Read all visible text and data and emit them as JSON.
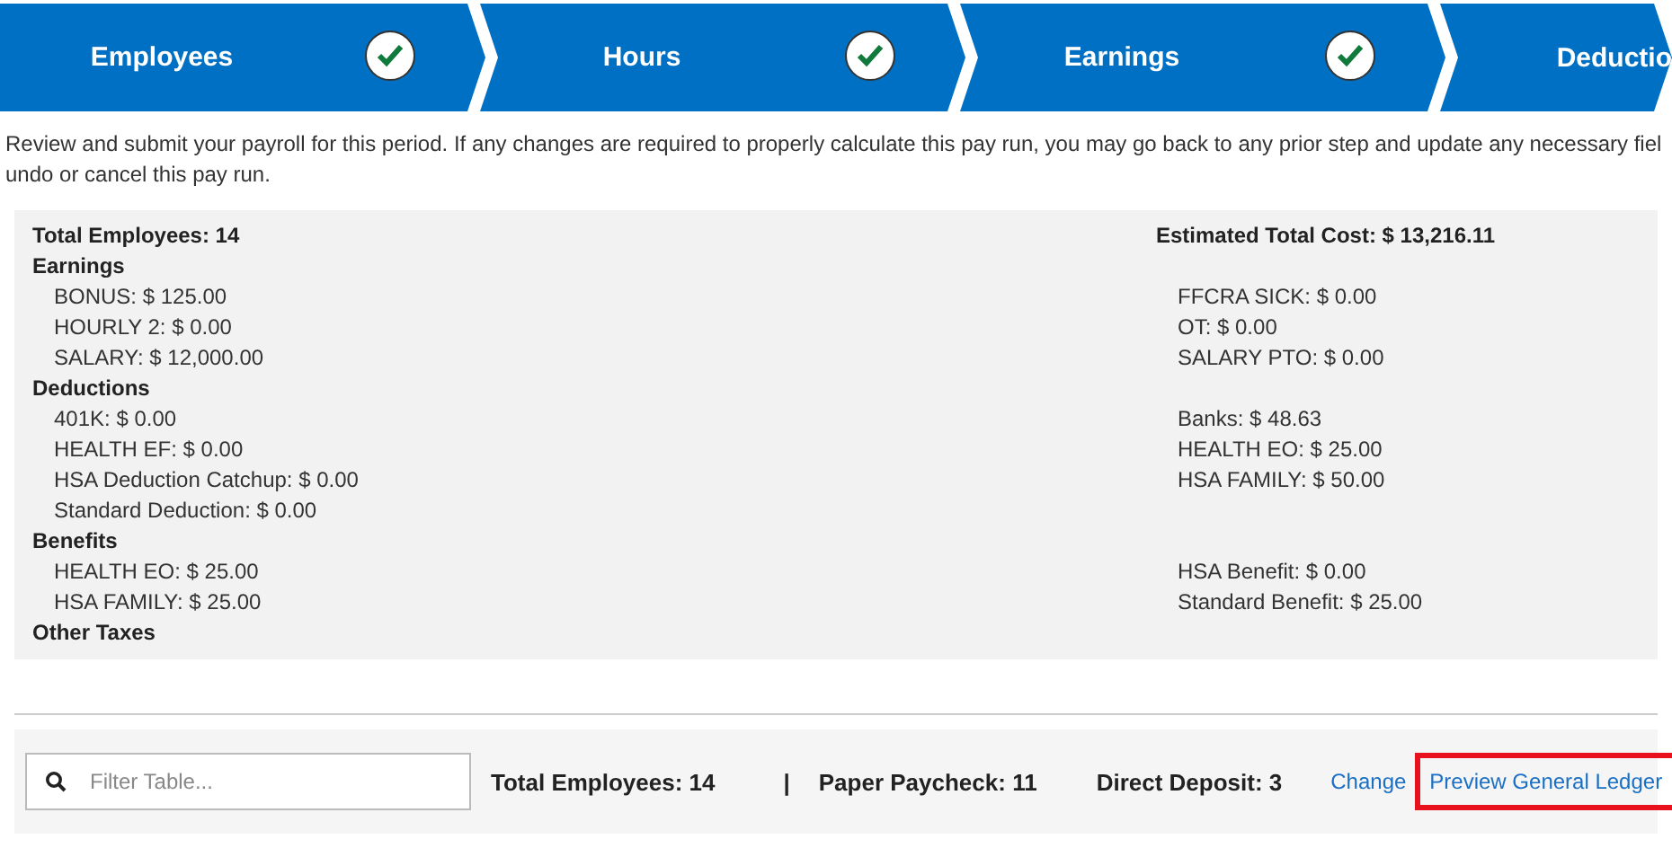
{
  "steps": [
    {
      "label": "Employees",
      "completed": true
    },
    {
      "label": "Hours",
      "completed": true
    },
    {
      "label": "Earnings",
      "completed": true
    },
    {
      "label": "Deductio"
    }
  ],
  "intro": [
    "Review and submit your payroll for this period. If any changes are required to properly calculate this pay run, you may go back to any prior step and update any necessary fiel",
    "undo or cancel this pay run."
  ],
  "summary": {
    "total_employees": "Total Employees: 14",
    "estimated_total_cost": "Estimated Total Cost: $ 13,216.11",
    "sections": [
      {
        "title": "Earnings",
        "left": [
          "BONUS: $ 125.00",
          "HOURLY 2: $ 0.00",
          "SALARY: $ 12,000.00"
        ],
        "right": [
          "FFCRA SICK: $ 0.00",
          "OT: $ 0.00",
          "SALARY PTO: $ 0.00"
        ]
      },
      {
        "title": "Deductions",
        "left": [
          "401K: $ 0.00",
          "HEALTH EF: $ 0.00",
          "HSA Deduction Catchup: $ 0.00",
          "Standard Deduction: $ 0.00"
        ],
        "right": [
          "Banks: $ 48.63",
          "HEALTH EO: $ 25.00",
          "HSA FAMILY: $ 50.00"
        ]
      },
      {
        "title": "Benefits",
        "left": [
          "HEALTH EO: $ 25.00",
          "HSA FAMILY: $ 25.00"
        ],
        "right": [
          "HSA Benefit: $ 0.00",
          "Standard Benefit: $ 25.00"
        ]
      },
      {
        "title": "Other Taxes"
      }
    ]
  },
  "footer": {
    "filter": {
      "placeholder": "Filter Table..."
    },
    "stats": [
      {
        "kind": "stat",
        "text": "Total Employees: 14"
      },
      {
        "kind": "separator",
        "text": "|"
      },
      {
        "kind": "stat",
        "text": "Paper Paycheck: 11"
      },
      {
        "kind": "stat",
        "text": "Direct Deposit: 3"
      }
    ],
    "links": [
      {
        "label": "Change",
        "highlighted": false
      },
      {
        "label": "Preview General Ledger",
        "highlighted": true
      }
    ]
  }
}
